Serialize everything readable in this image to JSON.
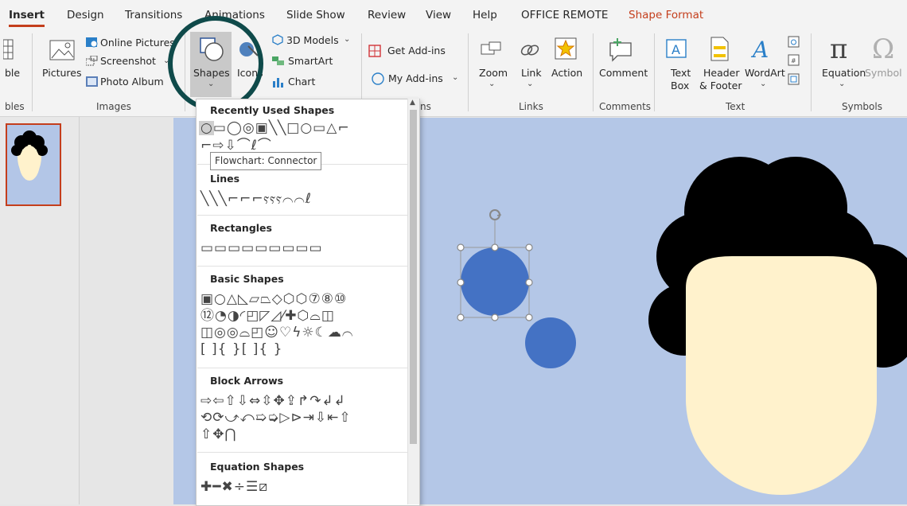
{
  "tabs": [
    "Insert",
    "Design",
    "Transitions",
    "Animations",
    "Slide Show",
    "Review",
    "View",
    "Help",
    "OFFICE REMOTE",
    "Shape Format"
  ],
  "ribbon": {
    "tables_partial": "ble",
    "tables_group_partial": "bles",
    "pictures": "Pictures",
    "online_pictures": "Online Pictures",
    "screenshot": "Screenshot",
    "photo_album": "Photo Album",
    "images_group": "Images",
    "shapes": "Shapes",
    "icons": "Icons",
    "models_3d": "3D Models",
    "smartart": "SmartArt",
    "chart": "Chart",
    "get_addins": "Get Add-ins",
    "my_addins": "My Add-ins",
    "addins_group_partial": "ns",
    "zoom": "Zoom",
    "link": "Link",
    "action": "Action",
    "links_group": "Links",
    "comment": "Comment",
    "comments_group": "Comments",
    "text_box_1": "Text",
    "text_box_2": "Box",
    "header_footer_1": "Header",
    "header_footer_2": "& Footer",
    "wordart": "WordArt",
    "text_group": "Text",
    "equation": "Equation",
    "symbol": "Symbol",
    "symbols_group": "Symbols"
  },
  "dropdown": {
    "recently_used": "Recently Used Shapes",
    "lines": "Lines",
    "rectangles": "Rectangles",
    "basic_shapes": "Basic Shapes",
    "block_arrows": "Block Arrows",
    "equation_shapes": "Equation Shapes",
    "tooltip": "Flowchart: Connector",
    "rows": {
      "recent1": "○▭◯◎▣╲╲□○▭△⌐",
      "recent2": "⌐⇨⇩⌒ℓ⌒",
      "lines": "╲╲╲⌐⌐⌐ⲋⲋⲋ⌒⌒ℓ",
      "rects": "▭▭▭▭▭▭▭▭▭",
      "basic1": "▣○△◺▱⏢◇⬡⬡⑦⑧⑩",
      "basic2": "⑫◔◑◜◰◸◿⁄✚⬡⌓◫",
      "basic3": "◫◎◎⌓◰☺♡ϟ☼☾☁⌒",
      "basic4": "[ ]{ }[ ]{ }",
      "arrows1": "⇨⇦⇧⇩⇔⇳✥⇪↱↷↲↲",
      "arrows2": "⟲⟳⤻⤺➯➭▷⊳⇥⇩⇤⇧",
      "arrows3": "⇧✥⋂",
      "eq": "✚━✖÷☰⧄"
    }
  },
  "colors": {
    "accent": "#c43e1c",
    "slide_bg": "#b4c7e7",
    "circle": "#4472c4",
    "face": "#fff2cc",
    "hair": "#000000",
    "highlight_ring": "#0f4a4a"
  }
}
